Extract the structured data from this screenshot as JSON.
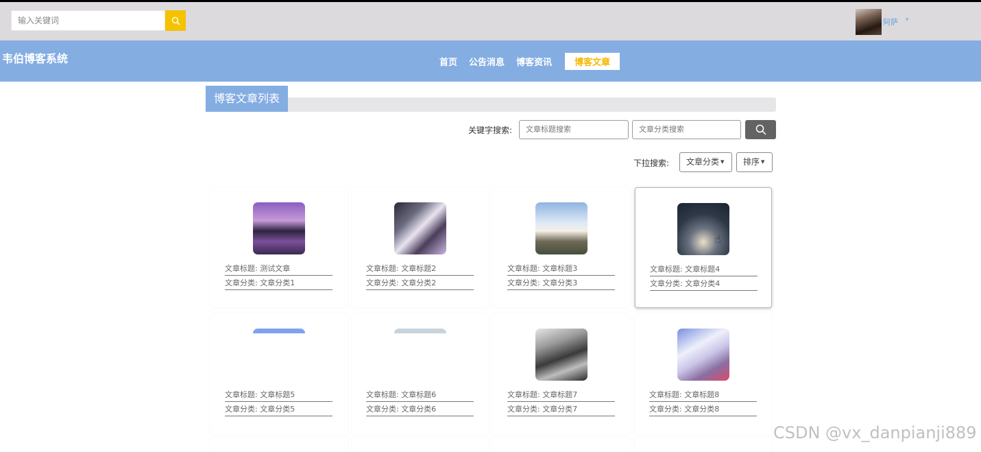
{
  "topbar": {
    "search_placeholder": "输入关键词",
    "search_icon": "search-icon",
    "username": "阿萨",
    "user_caret": "▾"
  },
  "navbar": {
    "brand": "韦伯博客系统",
    "items": [
      {
        "label": "首页"
      },
      {
        "label": "公告消息"
      },
      {
        "label": "博客资讯"
      },
      {
        "label": "博客文章",
        "active": true
      }
    ]
  },
  "section": {
    "title": "博客文章列表",
    "keyword_label": "关键字搜索:",
    "title_search_placeholder": "文章标题搜索",
    "category_search_placeholder": "文章分类搜索",
    "dropdown_label": "下拉搜索:",
    "category_dropdown": "文章分类",
    "sort_dropdown": "排序"
  },
  "articles": [
    {
      "title": "文章标题: 测试文章",
      "category": "文章分类: 文章分类1"
    },
    {
      "title": "文章标题: 文章标题2",
      "category": "文章分类: 文章分类2"
    },
    {
      "title": "文章标题: 文章标题3",
      "category": "文章分类: 文章分类3"
    },
    {
      "title": "文章标题: 文章标题4",
      "category": "文章分类: 文章分类4"
    },
    {
      "title": "文章标题: 文章标题5",
      "category": "文章分类: 文章分类5"
    },
    {
      "title": "文章标题: 文章标题6",
      "category": "文章分类: 文章分类6"
    },
    {
      "title": "文章标题: 文章标题7",
      "category": "文章分类: 文章分类7"
    },
    {
      "title": "文章标题: 文章标题8",
      "category": "文章分类: 文章分类8"
    }
  ],
  "watermark": "CSDN @vx_danpianji889",
  "colors": {
    "nav_blue": "#84ade2",
    "accent_yellow": "#f5c200",
    "topbar_gray": "#dcdadc"
  }
}
